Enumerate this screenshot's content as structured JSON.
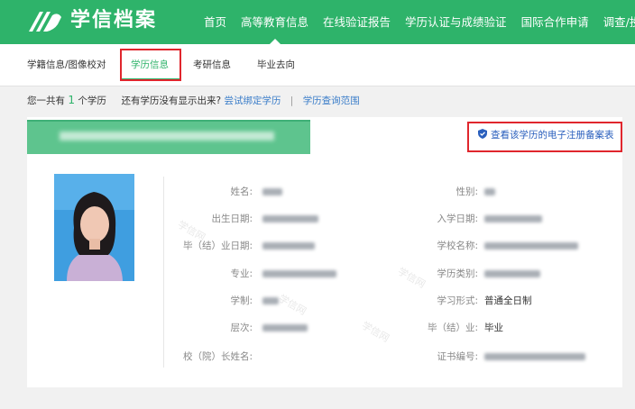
{
  "header": {
    "logo_text": "学信档案",
    "nav": [
      "首页",
      "高等教育信息",
      "在线验证报告",
      "学历认证与成绩验证",
      "国际合作申请",
      "调查/投票"
    ],
    "active_nav": "高等教育信息"
  },
  "subnav": {
    "items": [
      "学籍信息/图像校对",
      "学历信息",
      "考研信息",
      "毕业去向"
    ],
    "active": "学历信息"
  },
  "infobar": {
    "prefix": "您一共有",
    "count": "1",
    "suffix": "个学历",
    "question": "还有学历没有显示出来?",
    "bind_link": "尝试绑定学历",
    "separator": "|",
    "scope_link": "学历查询范围"
  },
  "record": {
    "verify_link": "查看该学历的电子注册备案表",
    "fields": {
      "name_label": "姓名:",
      "gender_label": "性别:",
      "birth_label": "出生日期:",
      "enroll_label": "入学日期:",
      "grad_date_label": "毕（结）业日期:",
      "school_label": "学校名称:",
      "major_label": "专业:",
      "category_label": "学历类别:",
      "duration_label": "学制:",
      "study_form_label": "学习形式:",
      "study_form_value": "普通全日制",
      "level_label": "层次:",
      "grad_status_label": "毕（结）业:",
      "grad_status_value": "毕业",
      "president_label": "校（院）长姓名:",
      "cert_label": "证书编号:"
    }
  },
  "colors": {
    "brand_green": "#2eb36a",
    "link_blue": "#3a7dc9",
    "highlight_red": "#e0262d"
  }
}
